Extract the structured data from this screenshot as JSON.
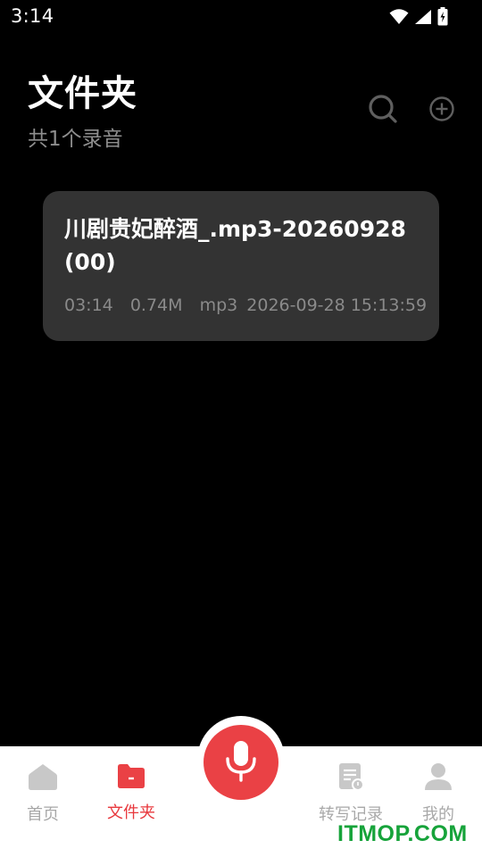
{
  "status_bar": {
    "time": "3:14",
    "icons": [
      "wifi-icon",
      "signal-icon",
      "battery-icon"
    ]
  },
  "header": {
    "title": "文件夹",
    "subtitle": "共1个录音",
    "actions": [
      "search-icon",
      "add-circle-icon"
    ]
  },
  "recordings": [
    {
      "name": "川剧贵妃醉酒_.mp3-20260928(00)",
      "duration": "03:14",
      "size": "0.74M",
      "format": "mp3",
      "datetime": "2026-09-28 15:13:59"
    }
  ],
  "bottom_nav": {
    "items": [
      {
        "label": "首页",
        "icon": "home-icon",
        "active": false
      },
      {
        "label": "文件夹",
        "icon": "folder-icon",
        "active": true
      },
      {
        "label": "转写记录",
        "icon": "transcript-icon",
        "active": false
      },
      {
        "label": "我的",
        "icon": "user-icon",
        "active": false
      }
    ],
    "center_action": "microphone-icon"
  },
  "colors": {
    "accent": "#ea4145",
    "background": "#000000",
    "card": "#333333",
    "nav_inactive": "#a8a8a8",
    "watermark": "#16a33a"
  },
  "watermark": "ITMOP.COM"
}
